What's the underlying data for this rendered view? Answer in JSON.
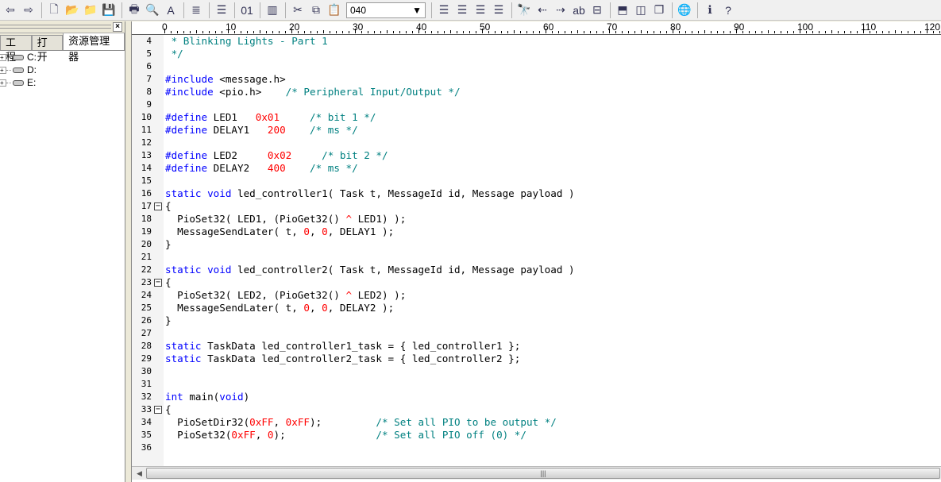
{
  "toolbar": {
    "icons": [
      "back-arrow-icon",
      "forward-arrow-icon",
      "new-file-icon",
      "open-folder-icon",
      "open-project-icon",
      "save-icon",
      "print-icon",
      "print-preview-icon",
      "font-icon",
      "document-icon",
      "indent-icon",
      "hex-view-icon",
      "column-mode-icon",
      "cut-icon",
      "copy-icon",
      "paste-icon"
    ],
    "combo_value": "040",
    "icons2": [
      "align-left-icon",
      "align-center-icon",
      "align-right-icon",
      "justify-icon",
      "find-icon",
      "find-prev-icon",
      "find-next-icon",
      "replace-icon",
      "goto-icon",
      "split-horizontal-icon",
      "split-vertical-icon",
      "cascade-windows-icon",
      "web-icon",
      "info-icon",
      "help-icon"
    ]
  },
  "left_panel": {
    "tabs": [
      "工程",
      "打开",
      "资源管理器"
    ],
    "active_tab": 2,
    "drives": [
      "C:",
      "D:",
      "E:"
    ]
  },
  "ruler": {
    "labels": [
      "0",
      "10",
      "20",
      "30",
      "40",
      "50",
      "60",
      "70",
      "80",
      "90",
      "100",
      "110",
      "120"
    ]
  },
  "colors": {
    "comment": "#008080",
    "keyword": "#0000ff",
    "number": "#ff0000"
  },
  "code": [
    {
      "n": "4",
      "t": [
        [
          "comment",
          " * Blinking Lights - Part 1"
        ]
      ]
    },
    {
      "n": "5",
      "t": [
        [
          "comment",
          " */"
        ]
      ]
    },
    {
      "n": "6",
      "t": []
    },
    {
      "n": "7",
      "t": [
        [
          "kw",
          "#include"
        ],
        [
          "plain",
          " <message.h>"
        ]
      ]
    },
    {
      "n": "8",
      "t": [
        [
          "kw",
          "#include"
        ],
        [
          "plain",
          " <pio.h>    "
        ],
        [
          "comment",
          "/* Peripheral Input/Output */"
        ]
      ]
    },
    {
      "n": "9",
      "t": []
    },
    {
      "n": "10",
      "t": [
        [
          "kw",
          "#define"
        ],
        [
          "plain",
          " LED1   "
        ],
        [
          "num2",
          "0x01"
        ],
        [
          "plain",
          "     "
        ],
        [
          "comment",
          "/* bit 1 */"
        ]
      ]
    },
    {
      "n": "11",
      "t": [
        [
          "kw",
          "#define"
        ],
        [
          "plain",
          " DELAY1   "
        ],
        [
          "num2",
          "200"
        ],
        [
          "plain",
          "    "
        ],
        [
          "comment",
          "/* ms */"
        ]
      ]
    },
    {
      "n": "12",
      "t": []
    },
    {
      "n": "13",
      "t": [
        [
          "kw",
          "#define"
        ],
        [
          "plain",
          " LED2     "
        ],
        [
          "num2",
          "0x02"
        ],
        [
          "plain",
          "     "
        ],
        [
          "comment",
          "/* bit 2 */"
        ]
      ]
    },
    {
      "n": "14",
      "t": [
        [
          "kw",
          "#define"
        ],
        [
          "plain",
          " DELAY2   "
        ],
        [
          "num2",
          "400"
        ],
        [
          "plain",
          "    "
        ],
        [
          "comment",
          "/* ms */"
        ]
      ]
    },
    {
      "n": "15",
      "t": []
    },
    {
      "n": "16",
      "t": [
        [
          "kw",
          "static void"
        ],
        [
          "plain",
          " led_controller1( Task t, MessageId id, Message payload )"
        ]
      ]
    },
    {
      "n": "17",
      "fold": true,
      "t": [
        [
          "plain",
          "{"
        ]
      ]
    },
    {
      "n": "18",
      "t": [
        [
          "plain",
          "  PioSet32( LED1, (PioGet32() "
        ],
        [
          "num2",
          "^"
        ],
        [
          "plain",
          " LED1) );"
        ]
      ]
    },
    {
      "n": "19",
      "t": [
        [
          "plain",
          "  MessageSendLater( t, "
        ],
        [
          "num2",
          "0"
        ],
        [
          "plain",
          ", "
        ],
        [
          "num2",
          "0"
        ],
        [
          "plain",
          ", DELAY1 );"
        ]
      ]
    },
    {
      "n": "20",
      "t": [
        [
          "plain",
          "}"
        ]
      ]
    },
    {
      "n": "21",
      "t": []
    },
    {
      "n": "22",
      "t": [
        [
          "kw",
          "static void"
        ],
        [
          "plain",
          " led_controller2( Task t, MessageId id, Message payload )"
        ]
      ]
    },
    {
      "n": "23",
      "fold": true,
      "t": [
        [
          "plain",
          "{"
        ]
      ]
    },
    {
      "n": "24",
      "t": [
        [
          "plain",
          "  PioSet32( LED2, (PioGet32() "
        ],
        [
          "num2",
          "^"
        ],
        [
          "plain",
          " LED2) );"
        ]
      ]
    },
    {
      "n": "25",
      "t": [
        [
          "plain",
          "  MessageSendLater( t, "
        ],
        [
          "num2",
          "0"
        ],
        [
          "plain",
          ", "
        ],
        [
          "num2",
          "0"
        ],
        [
          "plain",
          ", DELAY2 );"
        ]
      ]
    },
    {
      "n": "26",
      "t": [
        [
          "plain",
          "}"
        ]
      ]
    },
    {
      "n": "27",
      "t": []
    },
    {
      "n": "28",
      "t": [
        [
          "kw",
          "static"
        ],
        [
          "plain",
          " TaskData led_controller1_task = { led_controller1 };"
        ]
      ]
    },
    {
      "n": "29",
      "t": [
        [
          "kw",
          "static"
        ],
        [
          "plain",
          " TaskData led_controller2_task = { led_controller2 };"
        ]
      ]
    },
    {
      "n": "30",
      "t": []
    },
    {
      "n": "31",
      "t": []
    },
    {
      "n": "32",
      "t": [
        [
          "kw",
          "int"
        ],
        [
          "plain",
          " main("
        ],
        [
          "kw",
          "void"
        ],
        [
          "plain",
          ")"
        ]
      ]
    },
    {
      "n": "33",
      "fold": true,
      "t": [
        [
          "plain",
          "{"
        ]
      ]
    },
    {
      "n": "34",
      "t": [
        [
          "plain",
          "  PioSetDir32("
        ],
        [
          "num2",
          "0xFF"
        ],
        [
          "plain",
          ", "
        ],
        [
          "num2",
          "0xFF"
        ],
        [
          "plain",
          ");         "
        ],
        [
          "comment",
          "/* Set all PIO to be output */"
        ]
      ]
    },
    {
      "n": "35",
      "t": [
        [
          "plain",
          "  PioSet32("
        ],
        [
          "num2",
          "0xFF"
        ],
        [
          "plain",
          ", "
        ],
        [
          "num2",
          "0"
        ],
        [
          "plain",
          ");               "
        ],
        [
          "comment",
          "/* Set all PIO off (0) */"
        ]
      ]
    },
    {
      "n": "36",
      "t": []
    }
  ]
}
